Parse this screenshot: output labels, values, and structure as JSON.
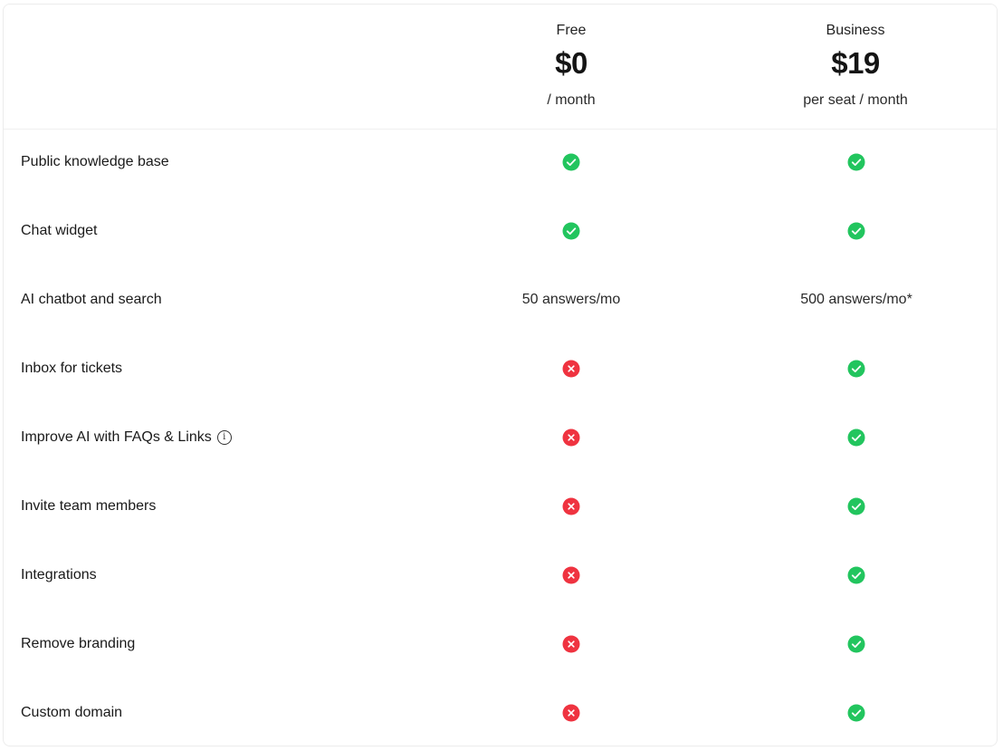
{
  "plans": [
    {
      "name": "Free",
      "price": "$0",
      "period": "/ month"
    },
    {
      "name": "Business",
      "price": "$19",
      "period": "per seat / month"
    }
  ],
  "colors": {
    "check": "#22c55e",
    "cross": "#ef3340"
  },
  "features": [
    {
      "label": "Public knowledge base",
      "info": false,
      "free": {
        "type": "check"
      },
      "business": {
        "type": "check"
      }
    },
    {
      "label": "Chat widget",
      "info": false,
      "free": {
        "type": "check"
      },
      "business": {
        "type": "check"
      }
    },
    {
      "label": "AI chatbot and search",
      "info": false,
      "free": {
        "type": "text",
        "text": "50 answers/mo"
      },
      "business": {
        "type": "text",
        "text": "500 answers/mo*"
      }
    },
    {
      "label": "Inbox for tickets",
      "info": false,
      "free": {
        "type": "cross"
      },
      "business": {
        "type": "check"
      }
    },
    {
      "label": "Improve AI with FAQs & Links",
      "info": true,
      "free": {
        "type": "cross"
      },
      "business": {
        "type": "check"
      }
    },
    {
      "label": "Invite team members",
      "info": false,
      "free": {
        "type": "cross"
      },
      "business": {
        "type": "check"
      }
    },
    {
      "label": "Integrations",
      "info": false,
      "free": {
        "type": "cross"
      },
      "business": {
        "type": "check"
      }
    },
    {
      "label": "Remove branding",
      "info": false,
      "free": {
        "type": "cross"
      },
      "business": {
        "type": "check"
      }
    },
    {
      "label": "Custom domain",
      "info": false,
      "free": {
        "type": "cross"
      },
      "business": {
        "type": "check"
      }
    }
  ]
}
